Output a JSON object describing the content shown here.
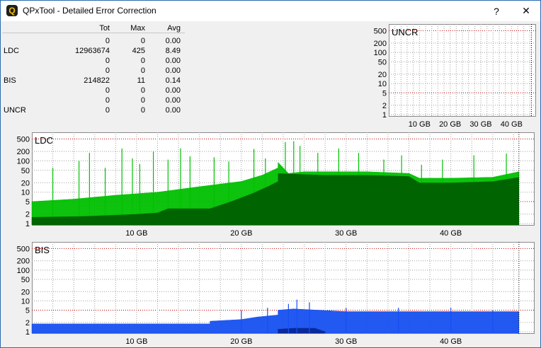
{
  "window": {
    "title": "QPxTool - Detailed Error Correction",
    "help_label": "?",
    "close_label": "✕",
    "icon_letter": "Q"
  },
  "stats": {
    "headers": {
      "tot": "Tot",
      "max": "Max",
      "avg": "Avg"
    },
    "rows": [
      {
        "label": "",
        "tot": "0",
        "max": "0",
        "avg": "0.00"
      },
      {
        "label": "LDC",
        "tot": "12963674",
        "max": "425",
        "avg": "8.49"
      },
      {
        "label": "",
        "tot": "0",
        "max": "0",
        "avg": "0.00"
      },
      {
        "label": "",
        "tot": "0",
        "max": "0",
        "avg": "0.00"
      },
      {
        "label": "BIS",
        "tot": "214822",
        "max": "11",
        "avg": "0.14"
      },
      {
        "label": "",
        "tot": "0",
        "max": "0",
        "avg": "0.00"
      },
      {
        "label": "",
        "tot": "0",
        "max": "0",
        "avg": "0.00"
      },
      {
        "label": "UNCR",
        "tot": "0",
        "max": "0",
        "avg": "0.00"
      }
    ]
  },
  "colors": {
    "ldc_bright": "#00c000",
    "ldc_dark": "#006400",
    "bis_bright": "#1650f0",
    "bis_dark": "#0a2a9a",
    "threshold": "#c00000",
    "grid": "#a0a0a0",
    "marker": "#000000"
  },
  "chart_data": [
    {
      "id": "uncr",
      "type": "area",
      "title": "UNCR",
      "y_scale": "log",
      "y_ticks": [
        "500",
        "200",
        "100",
        "50",
        "20",
        "10",
        "5",
        "2",
        "1"
      ],
      "x_ticks": [
        "10 GB",
        "20 GB",
        "30 GB",
        "40 GB"
      ],
      "x_tick_values": [
        10,
        20,
        30,
        40
      ],
      "xlim": [
        0,
        48
      ],
      "ylim": [
        1,
        700
      ],
      "threshold_lines": [
        500,
        5
      ],
      "end_marker_x": 46.5,
      "series": []
    },
    {
      "id": "ldc",
      "type": "area",
      "title": "LDC",
      "y_scale": "log",
      "y_ticks": [
        "500",
        "200",
        "100",
        "50",
        "20",
        "10",
        "5",
        "2",
        "1"
      ],
      "x_ticks": [
        "10 GB",
        "20 GB",
        "30 GB",
        "40 GB"
      ],
      "x_tick_values": [
        10,
        20,
        30,
        40
      ],
      "xlim": [
        0,
        48
      ],
      "ylim": [
        1,
        700
      ],
      "threshold_lines": [
        500,
        5
      ],
      "end_marker_x": 46.5,
      "series": [
        {
          "style": "dark",
          "points": [
            [
              0,
              1.6
            ],
            [
              5,
              1.7
            ],
            [
              10,
              2.0
            ],
            [
              12,
              2.2
            ],
            [
              13,
              3.0
            ],
            [
              17,
              3.0
            ],
            [
              19,
              5
            ],
            [
              21,
              9
            ],
            [
              22.5,
              15
            ],
            [
              23.5,
              22
            ],
            [
              23.5,
              40
            ],
            [
              25,
              38
            ],
            [
              28,
              35
            ],
            [
              32,
              35
            ],
            [
              36,
              32
            ],
            [
              37,
              20
            ],
            [
              40,
              20
            ],
            [
              44,
              22
            ],
            [
              46.5,
              30
            ]
          ]
        },
        {
          "style": "bright",
          "points": [
            [
              0,
              5
            ],
            [
              4,
              6
            ],
            [
              8,
              8
            ],
            [
              12,
              10
            ],
            [
              16,
              15
            ],
            [
              20,
              22
            ],
            [
              22,
              35
            ],
            [
              23.5,
              60
            ],
            [
              23.5,
              90
            ],
            [
              24.5,
              40
            ],
            [
              26,
              45
            ],
            [
              28,
              45
            ],
            [
              32,
              45
            ],
            [
              36,
              40
            ],
            [
              37,
              28
            ],
            [
              40,
              28
            ],
            [
              44,
              30
            ],
            [
              46.5,
              45
            ]
          ]
        },
        {
          "style": "spikes",
          "points": [
            [
              2.0,
              60
            ],
            [
              4.5,
              100
            ],
            [
              5.5,
              180
            ],
            [
              7.0,
              60
            ],
            [
              8.6,
              250
            ],
            [
              9.6,
              120
            ],
            [
              10.3,
              80
            ],
            [
              11.6,
              200
            ],
            [
              13.0,
              110
            ],
            [
              14.2,
              250
            ],
            [
              15.1,
              140
            ],
            [
              17.4,
              130
            ],
            [
              18.8,
              95
            ],
            [
              21.2,
              240
            ],
            [
              22.3,
              120
            ],
            [
              24.2,
              400
            ],
            [
              25.0,
              425
            ],
            [
              25.6,
              300
            ],
            [
              27.3,
              180
            ],
            [
              29.3,
              250
            ],
            [
              31.2,
              180
            ],
            [
              33.6,
              110
            ],
            [
              35.3,
              150
            ],
            [
              37.2,
              75
            ],
            [
              39.2,
              110
            ],
            [
              42.2,
              150
            ],
            [
              45.3,
              170
            ]
          ]
        }
      ]
    },
    {
      "id": "bis",
      "type": "area",
      "title": "BIS",
      "y_scale": "log",
      "y_ticks": [
        "500",
        "200",
        "100",
        "50",
        "20",
        "10",
        "5",
        "2",
        "1"
      ],
      "x_ticks": [
        "10 GB",
        "20 GB",
        "30 GB",
        "40 GB"
      ],
      "x_tick_values": [
        10,
        20,
        30,
        40
      ],
      "xlim": [
        0,
        48
      ],
      "ylim": [
        1,
        700
      ],
      "threshold_lines": [
        500,
        5
      ],
      "end_marker_x": 46.5,
      "series": [
        {
          "style": "bright",
          "points": [
            [
              0,
              1.8
            ],
            [
              17,
              1.8
            ],
            [
              17,
              2.2
            ],
            [
              20,
              2.5
            ],
            [
              21.5,
              3
            ],
            [
              23.5,
              3.5
            ],
            [
              23.5,
              5
            ],
            [
              25,
              5.5
            ],
            [
              30,
              4.5
            ],
            [
              40,
              4.5
            ],
            [
              46.5,
              4.5
            ]
          ]
        },
        {
          "style": "dark",
          "points": [
            [
              23.5,
              1.2
            ],
            [
              25,
              1.3
            ],
            [
              27,
              1.3
            ],
            [
              28,
              1.0
            ]
          ]
        },
        {
          "style": "spikes",
          "points": [
            [
              20.0,
              5
            ],
            [
              22.5,
              6
            ],
            [
              24.5,
              8
            ],
            [
              25.3,
              11
            ],
            [
              26.5,
              9
            ],
            [
              30.0,
              6
            ],
            [
              35.0,
              6
            ],
            [
              40.0,
              6
            ],
            [
              44.0,
              5
            ]
          ]
        }
      ]
    }
  ]
}
